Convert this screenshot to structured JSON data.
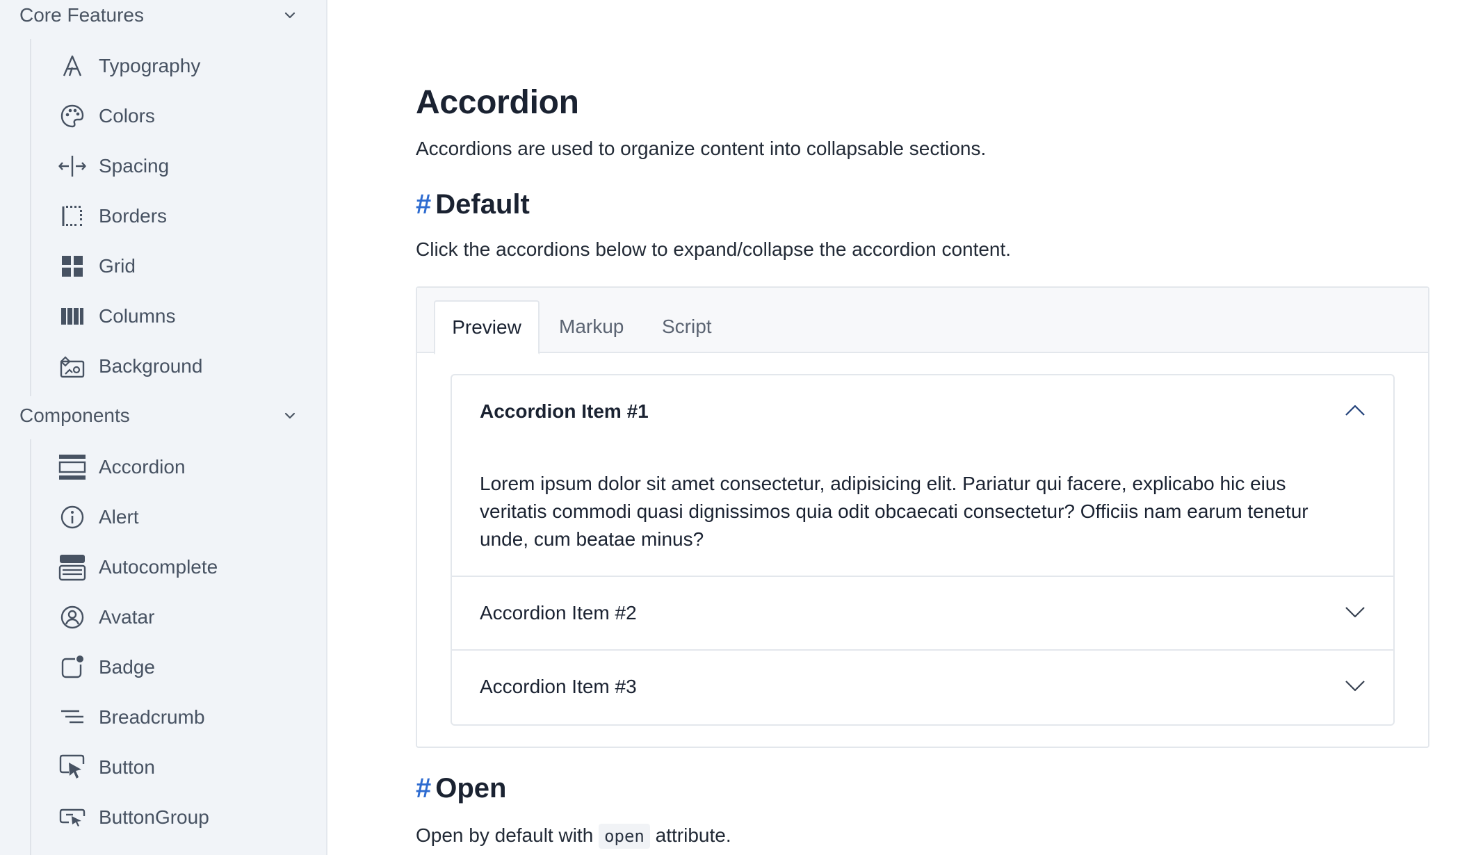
{
  "sidebar": {
    "sections": [
      {
        "title": "Core Features",
        "items": [
          {
            "label": "Typography",
            "icon": "typography-icon"
          },
          {
            "label": "Colors",
            "icon": "palette-icon"
          },
          {
            "label": "Spacing",
            "icon": "spacing-icon"
          },
          {
            "label": "Borders",
            "icon": "borders-icon"
          },
          {
            "label": "Grid",
            "icon": "grid-icon"
          },
          {
            "label": "Columns",
            "icon": "columns-icon"
          },
          {
            "label": "Background",
            "icon": "background-icon"
          }
        ]
      },
      {
        "title": "Components",
        "items": [
          {
            "label": "Accordion",
            "icon": "accordion-icon"
          },
          {
            "label": "Alert",
            "icon": "info-icon"
          },
          {
            "label": "Autocomplete",
            "icon": "autocomplete-icon"
          },
          {
            "label": "Avatar",
            "icon": "avatar-icon"
          },
          {
            "label": "Badge",
            "icon": "badge-icon"
          },
          {
            "label": "Breadcrumb",
            "icon": "breadcrumb-icon"
          },
          {
            "label": "Button",
            "icon": "cursor-icon"
          },
          {
            "label": "ButtonGroup",
            "icon": "button-group-icon"
          }
        ]
      }
    ]
  },
  "main": {
    "title": "Accordion",
    "lead": "Accordions are used to organize content into collapsable sections.",
    "sections": [
      {
        "hash": "#",
        "heading": "Default",
        "description": "Click the accordions below to expand/collapse the accordion content."
      },
      {
        "hash": "#",
        "heading": "Open",
        "description_before": "Open by default with",
        "code": "open",
        "description_after": "attribute."
      }
    ],
    "tabs": [
      {
        "label": "Preview",
        "active": true
      },
      {
        "label": "Markup",
        "active": false
      },
      {
        "label": "Script",
        "active": false
      }
    ],
    "accordion": {
      "items": [
        {
          "title": "Accordion Item #1",
          "expanded": true,
          "body": "Lorem ipsum dolor sit amet consectetur, adipisicing elit. Pariatur qui facere, explicabo hic eius veritatis commodi quasi dignissimos quia odit obcaecati consectetur? Officiis nam earum tenetur unde, cum beatae minus?"
        },
        {
          "title": "Accordion Item #2",
          "expanded": false
        },
        {
          "title": "Accordion Item #3",
          "expanded": false
        }
      ]
    }
  },
  "colors": {
    "accent": "#2d6bd0",
    "sidebar_bg": "#f1f4f8",
    "text": "#1a2231"
  }
}
